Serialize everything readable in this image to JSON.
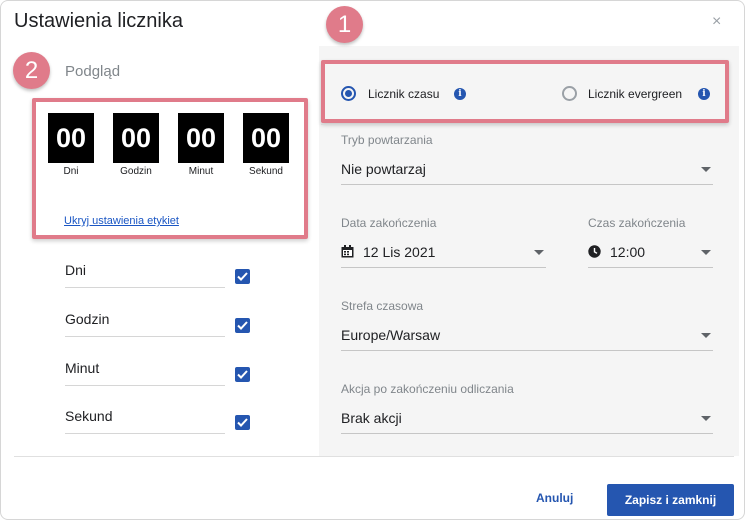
{
  "dialog": {
    "title": "Ustawienia licznika",
    "close_symbol": "×"
  },
  "callouts": {
    "one": "1",
    "two": "2"
  },
  "preview": {
    "label": "Podgląd",
    "units": [
      {
        "value": "00",
        "label": "Dni"
      },
      {
        "value": "00",
        "label": "Godzin"
      },
      {
        "value": "00",
        "label": "Minut"
      },
      {
        "value": "00",
        "label": "Sekund"
      }
    ],
    "hide_labels_link": "Ukryj ustawienia etykiet"
  },
  "label_settings": [
    {
      "label": "Dni",
      "checked": true
    },
    {
      "label": "Godzin",
      "checked": true
    },
    {
      "label": "Minut",
      "checked": true
    },
    {
      "label": "Sekund",
      "checked": true
    }
  ],
  "counter_type": {
    "options": [
      {
        "label": "Licznik czasu",
        "selected": true
      },
      {
        "label": "Licznik evergreen",
        "selected": false
      }
    ]
  },
  "form": {
    "repeat_mode": {
      "label": "Tryb powtarzania",
      "value": "Nie powtarzaj"
    },
    "end_date": {
      "label": "Data zakończenia",
      "value": "12 Lis 2021"
    },
    "end_time": {
      "label": "Czas zakończenia",
      "value": "12:00"
    },
    "timezone": {
      "label": "Strefa czasowa",
      "value": "Europe/Warsaw"
    },
    "after_action": {
      "label": "Akcja po zakończeniu odliczania",
      "value": "Brak akcji"
    }
  },
  "footer": {
    "cancel_label": "Anuluj",
    "save_label": "Zapisz i zamknij"
  },
  "colors": {
    "accent": "#2556b0",
    "highlight": "#e07b8a",
    "panel_bg": "#f5f5f5"
  }
}
